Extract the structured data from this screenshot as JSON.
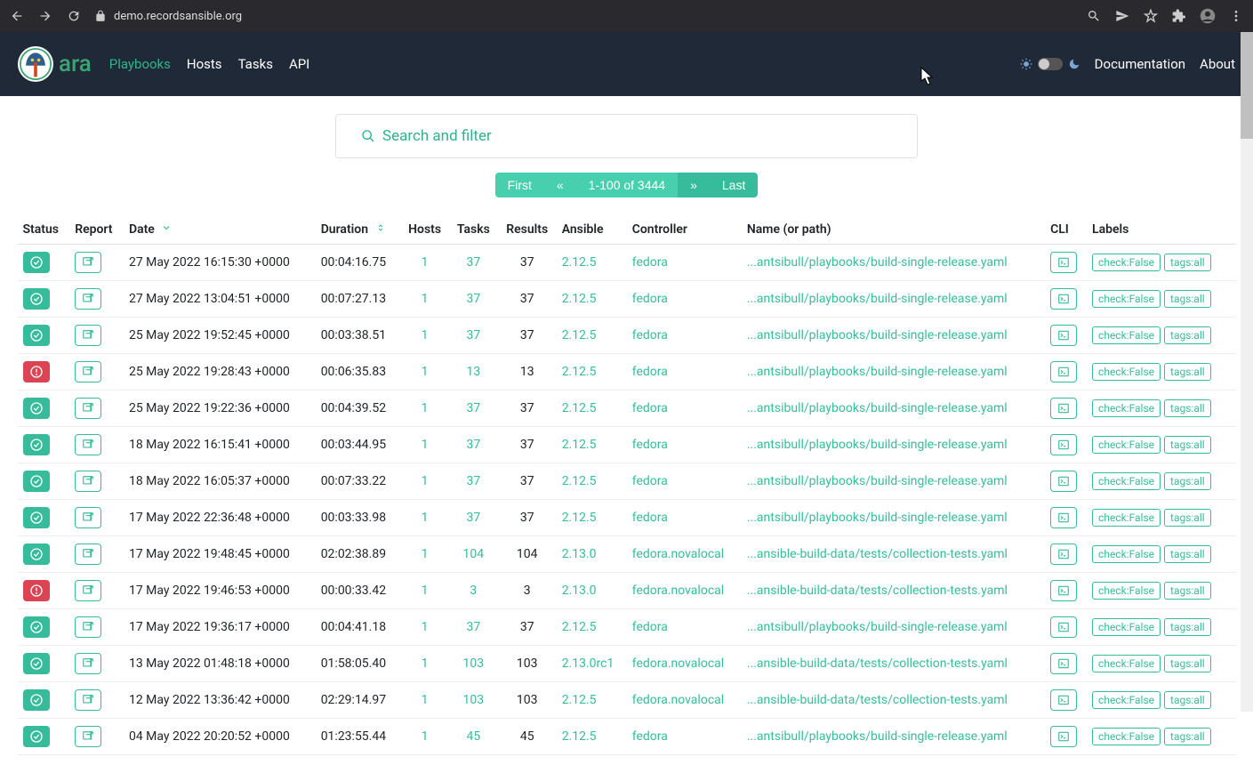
{
  "browser": {
    "url": "demo.recordsansible.org"
  },
  "header": {
    "logo_text": "ara",
    "nav": [
      {
        "label": "Playbooks",
        "active": true
      },
      {
        "label": "Hosts",
        "active": false
      },
      {
        "label": "Tasks",
        "active": false
      },
      {
        "label": "API",
        "active": false
      }
    ],
    "right_links": [
      {
        "label": "Documentation"
      },
      {
        "label": "About"
      }
    ]
  },
  "search": {
    "placeholder": "Search and filter"
  },
  "pagination": {
    "first": "First",
    "prev": "«",
    "range": "1-100 of 3444",
    "next": "»",
    "last": "Last"
  },
  "columns": {
    "status": "Status",
    "report": "Report",
    "date": "Date",
    "duration": "Duration",
    "hosts": "Hosts",
    "tasks": "Tasks",
    "results": "Results",
    "ansible": "Ansible",
    "controller": "Controller",
    "name": "Name (or path)",
    "cli": "CLI",
    "labels": "Labels"
  },
  "rows": [
    {
      "status": "ok",
      "date": "27 May 2022 16:15:30 +0000",
      "duration": "00:04:16.75",
      "hosts": "1",
      "tasks": "37",
      "results": "37",
      "ansible": "2.12.5",
      "controller": "fedora",
      "name": "...antsibull/playbooks/build-single-release.yaml",
      "labels": [
        "check:False",
        "tags:all"
      ]
    },
    {
      "status": "ok",
      "date": "27 May 2022 13:04:51 +0000",
      "duration": "00:07:27.13",
      "hosts": "1",
      "tasks": "37",
      "results": "37",
      "ansible": "2.12.5",
      "controller": "fedora",
      "name": "...antsibull/playbooks/build-single-release.yaml",
      "labels": [
        "check:False",
        "tags:all"
      ]
    },
    {
      "status": "ok",
      "date": "25 May 2022 19:52:45 +0000",
      "duration": "00:03:38.51",
      "hosts": "1",
      "tasks": "37",
      "results": "37",
      "ansible": "2.12.5",
      "controller": "fedora",
      "name": "...antsibull/playbooks/build-single-release.yaml",
      "labels": [
        "check:False",
        "tags:all"
      ]
    },
    {
      "status": "fail",
      "date": "25 May 2022 19:28:43 +0000",
      "duration": "00:06:35.83",
      "hosts": "1",
      "tasks": "13",
      "results": "13",
      "ansible": "2.12.5",
      "controller": "fedora",
      "name": "...antsibull/playbooks/build-single-release.yaml",
      "labels": [
        "check:False",
        "tags:all"
      ]
    },
    {
      "status": "ok",
      "date": "25 May 2022 19:22:36 +0000",
      "duration": "00:04:39.52",
      "hosts": "1",
      "tasks": "37",
      "results": "37",
      "ansible": "2.12.5",
      "controller": "fedora",
      "name": "...antsibull/playbooks/build-single-release.yaml",
      "labels": [
        "check:False",
        "tags:all"
      ]
    },
    {
      "status": "ok",
      "date": "18 May 2022 16:15:41 +0000",
      "duration": "00:03:44.95",
      "hosts": "1",
      "tasks": "37",
      "results": "37",
      "ansible": "2.12.5",
      "controller": "fedora",
      "name": "...antsibull/playbooks/build-single-release.yaml",
      "labels": [
        "check:False",
        "tags:all"
      ]
    },
    {
      "status": "ok",
      "date": "18 May 2022 16:05:37 +0000",
      "duration": "00:07:33.22",
      "hosts": "1",
      "tasks": "37",
      "results": "37",
      "ansible": "2.12.5",
      "controller": "fedora",
      "name": "...antsibull/playbooks/build-single-release.yaml",
      "labels": [
        "check:False",
        "tags:all"
      ]
    },
    {
      "status": "ok",
      "date": "17 May 2022 22:36:48 +0000",
      "duration": "00:03:33.98",
      "hosts": "1",
      "tasks": "37",
      "results": "37",
      "ansible": "2.12.5",
      "controller": "fedora",
      "name": "...antsibull/playbooks/build-single-release.yaml",
      "labels": [
        "check:False",
        "tags:all"
      ]
    },
    {
      "status": "ok",
      "date": "17 May 2022 19:48:45 +0000",
      "duration": "02:02:38.89",
      "hosts": "1",
      "tasks": "104",
      "results": "104",
      "ansible": "2.13.0",
      "controller": "fedora.novalocal",
      "name": "...ansible-build-data/tests/collection-tests.yaml",
      "labels": [
        "check:False",
        "tags:all"
      ]
    },
    {
      "status": "fail",
      "date": "17 May 2022 19:46:53 +0000",
      "duration": "00:00:33.42",
      "hosts": "1",
      "tasks": "3",
      "results": "3",
      "ansible": "2.13.0",
      "controller": "fedora.novalocal",
      "name": "...ansible-build-data/tests/collection-tests.yaml",
      "labels": [
        "check:False",
        "tags:all"
      ]
    },
    {
      "status": "ok",
      "date": "17 May 2022 19:36:17 +0000",
      "duration": "00:04:41.18",
      "hosts": "1",
      "tasks": "37",
      "results": "37",
      "ansible": "2.12.5",
      "controller": "fedora",
      "name": "...antsibull/playbooks/build-single-release.yaml",
      "labels": [
        "check:False",
        "tags:all"
      ]
    },
    {
      "status": "ok",
      "date": "13 May 2022 01:48:18 +0000",
      "duration": "01:58:05.40",
      "hosts": "1",
      "tasks": "103",
      "results": "103",
      "ansible": "2.13.0rc1",
      "controller": "fedora.novalocal",
      "name": "...ansible-build-data/tests/collection-tests.yaml",
      "labels": [
        "check:False",
        "tags:all"
      ]
    },
    {
      "status": "ok",
      "date": "12 May 2022 13:36:42 +0000",
      "duration": "02:29:14.97",
      "hosts": "1",
      "tasks": "103",
      "results": "103",
      "ansible": "2.12.5",
      "controller": "fedora.novalocal",
      "name": "...ansible-build-data/tests/collection-tests.yaml",
      "labels": [
        "check:False",
        "tags:all"
      ]
    },
    {
      "status": "ok",
      "date": "04 May 2022 20:20:52 +0000",
      "duration": "01:23:55.44",
      "hosts": "1",
      "tasks": "45",
      "results": "45",
      "ansible": "2.12.5",
      "controller": "fedora",
      "name": "...antsibull/playbooks/build-single-release.yaml",
      "labels": [
        "check:False",
        "tags:all"
      ]
    }
  ]
}
